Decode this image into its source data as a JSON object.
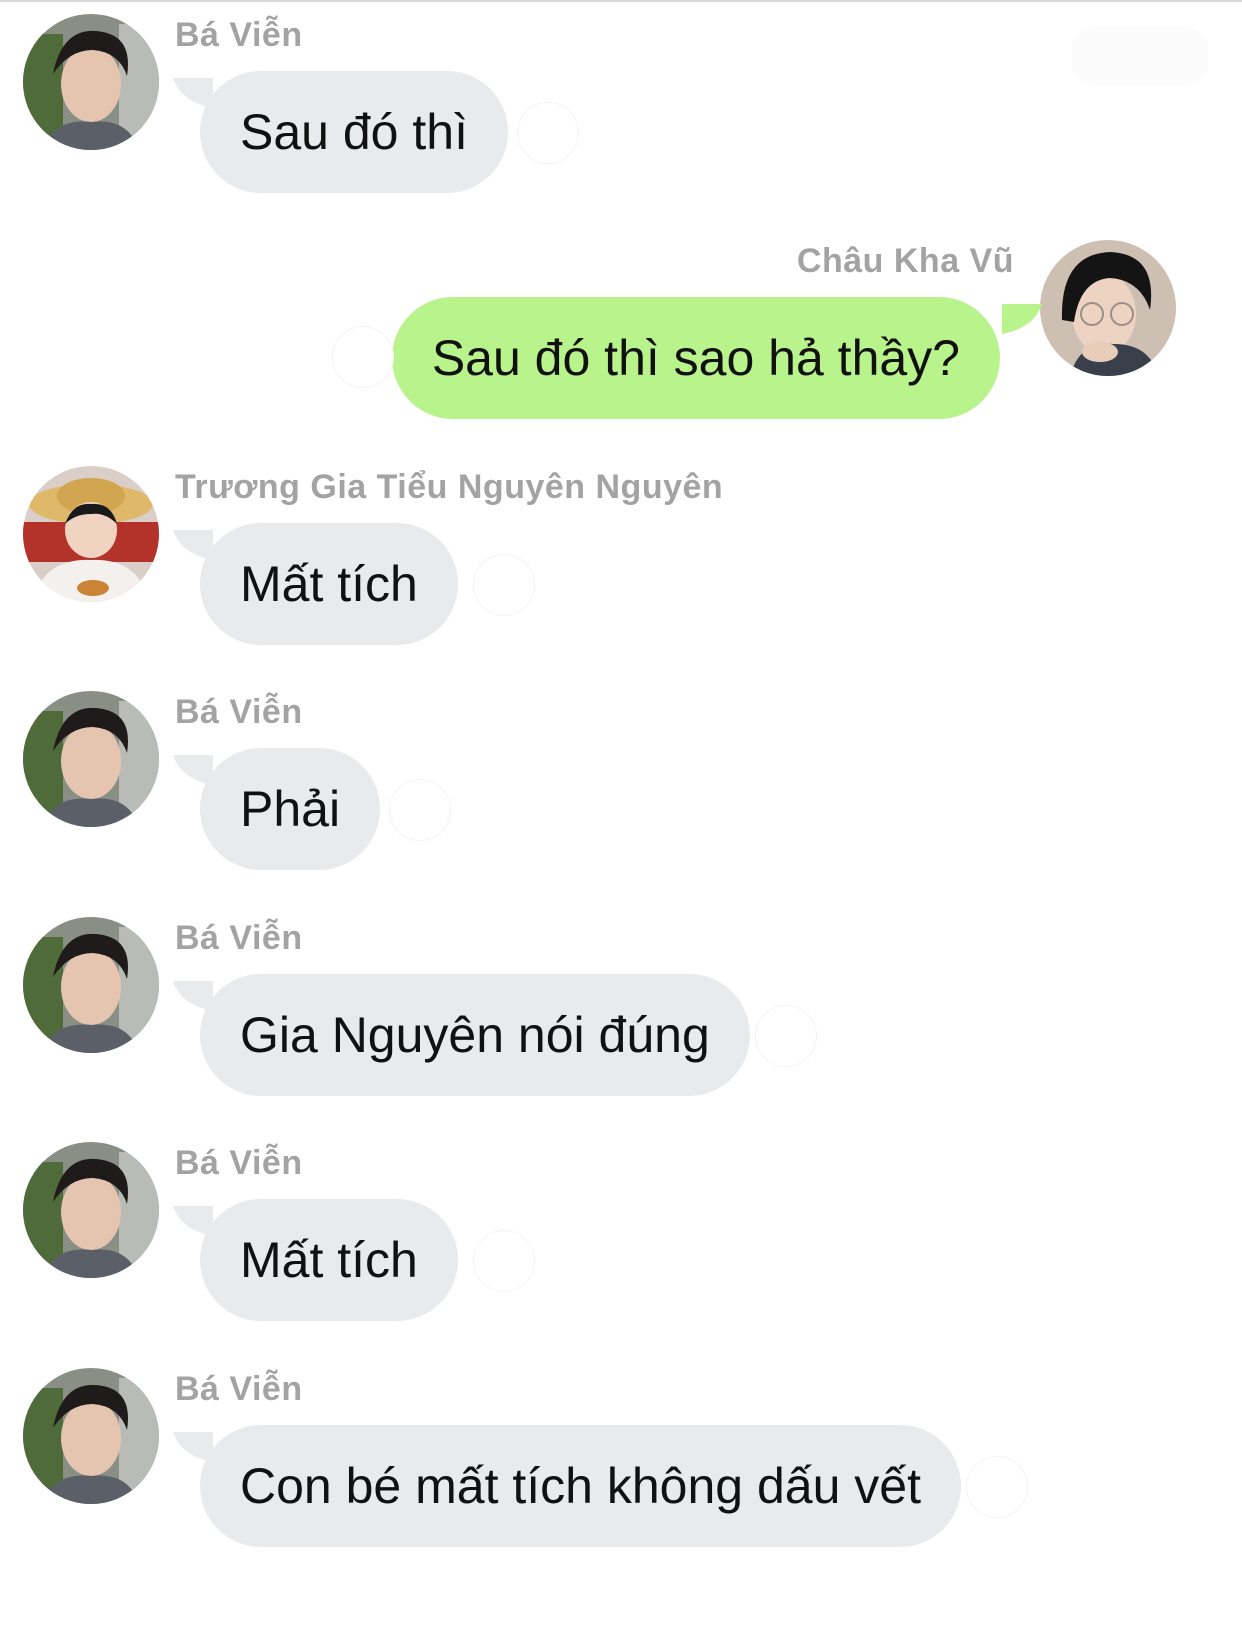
{
  "messages": [
    {
      "side": "left",
      "sender": "Bá Viễn",
      "text": "Sau đó thì",
      "avatar": "ba-vien"
    },
    {
      "side": "right",
      "sender": "Châu Kha Vũ",
      "text": "Sau đó thì sao hả thầy?",
      "avatar": "chau-kha-vu"
    },
    {
      "side": "left",
      "sender": "Trương Gia Tiểu Nguyên Nguyên",
      "text": "Mất tích",
      "avatar": "truong-gia-nguyen"
    },
    {
      "side": "left",
      "sender": "Bá Viễn",
      "text": "Phải",
      "avatar": "ba-vien"
    },
    {
      "side": "left",
      "sender": "Bá Viễn",
      "text": "Gia Nguyên nói đúng",
      "avatar": "ba-vien"
    },
    {
      "side": "left",
      "sender": "Bá Viễn",
      "text": "Mất tích",
      "avatar": "ba-vien"
    },
    {
      "side": "left",
      "sender": "Bá Viễn",
      "text": "Con bé mất tích không dấu vết",
      "avatar": "ba-vien"
    }
  ],
  "colors": {
    "incoming_bubble": "#e9eaec",
    "outgoing_bubble": "#b9f38c",
    "sender_name": "#a3a3a3",
    "message_text": "#111111"
  }
}
